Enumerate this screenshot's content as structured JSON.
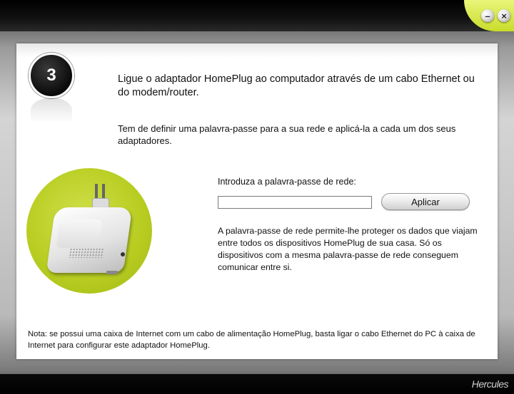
{
  "window": {
    "minimize_symbol": "–",
    "close_symbol": "×",
    "brand": "Hercules"
  },
  "step": {
    "number": "3"
  },
  "content": {
    "title": "Ligue o adaptador HomePlug ao computador através de um cabo Ethernet ou do modem/router.",
    "subtitle": "Tem de definir uma palavra-passe para a sua rede e aplicá-la a cada um dos seus adaptadores.",
    "password_label": "Introduza a palavra-passe de rede:",
    "password_value": "",
    "apply_label": "Aplicar",
    "info": "A palavra-passe de rede permite-lhe proteger os dados que viajam entre todos os dispositivos HomePlug de sua casa. Só os dispositivos com a mesma palavra-passe de rede conseguem comunicar entre si.",
    "note": "Nota: se possui uma caixa de Internet com um cabo de alimentação HomePlug, basta ligar o cabo Ethernet do PC à caixa de Internet para configurar este adaptador HomePlug."
  },
  "icons": {
    "minimize": "minimize-icon",
    "close": "close-icon",
    "device": "homeplug-adapter-icon"
  },
  "colors": {
    "accent": "#c9dc2a",
    "panel": "#ffffff"
  }
}
